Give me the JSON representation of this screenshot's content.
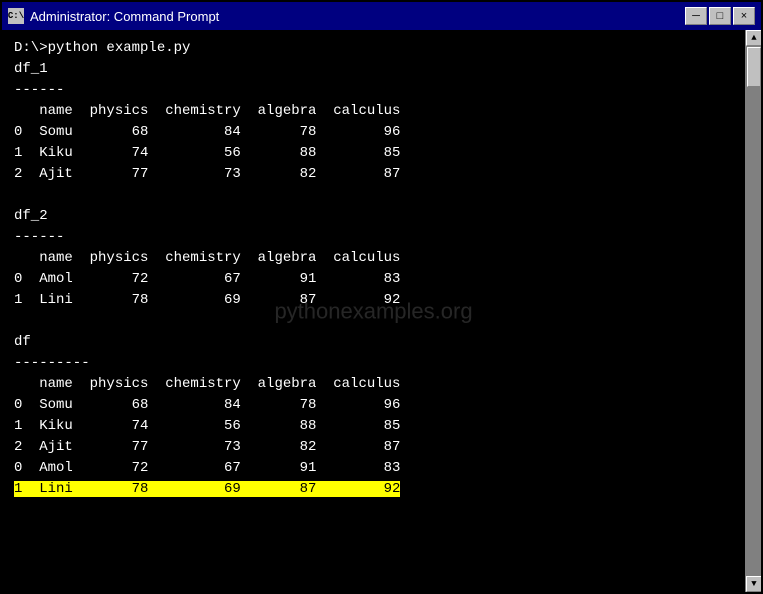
{
  "window": {
    "title": "Administrator: Command Prompt",
    "icon_label": "C:\\",
    "minimize_label": "─",
    "maximize_label": "□",
    "close_label": "×"
  },
  "terminal": {
    "command": "D:\\>python example.py",
    "watermark": "pythonexamples.org",
    "df1": {
      "label": "df_1",
      "separator": "------",
      "headers": "   name  physics  chemistry  algebra  calculus",
      "rows": [
        "0   Somu       68         84       78        96",
        "1   Kiku       74         56       88        85",
        "2   Ajit       77         73       82        87"
      ]
    },
    "df2": {
      "label": "df_2",
      "separator": "------",
      "headers": "   name  physics  chemistry  algebra  calculus",
      "rows": [
        "0   Amol       72         67       91        83",
        "1   Lini       78         69       87        92"
      ]
    },
    "df": {
      "label": "df",
      "separator": "---------",
      "headers": "   name  physics  chemistry  algebra  calculus",
      "rows": [
        {
          "index": "0",
          "data": "   Somu       68         84       78        96",
          "highlight": false
        },
        {
          "index": "1",
          "data": "   Kiku       74         56       88        85",
          "highlight": false
        },
        {
          "index": "2",
          "data": "   Ajit       77         73       82        87",
          "highlight": false
        },
        {
          "index": "0",
          "data": "   Amol       72         67       91        83",
          "highlight": false
        },
        {
          "index": "1",
          "data": "   Lini       78         69       87        92",
          "highlight": true
        }
      ]
    }
  }
}
